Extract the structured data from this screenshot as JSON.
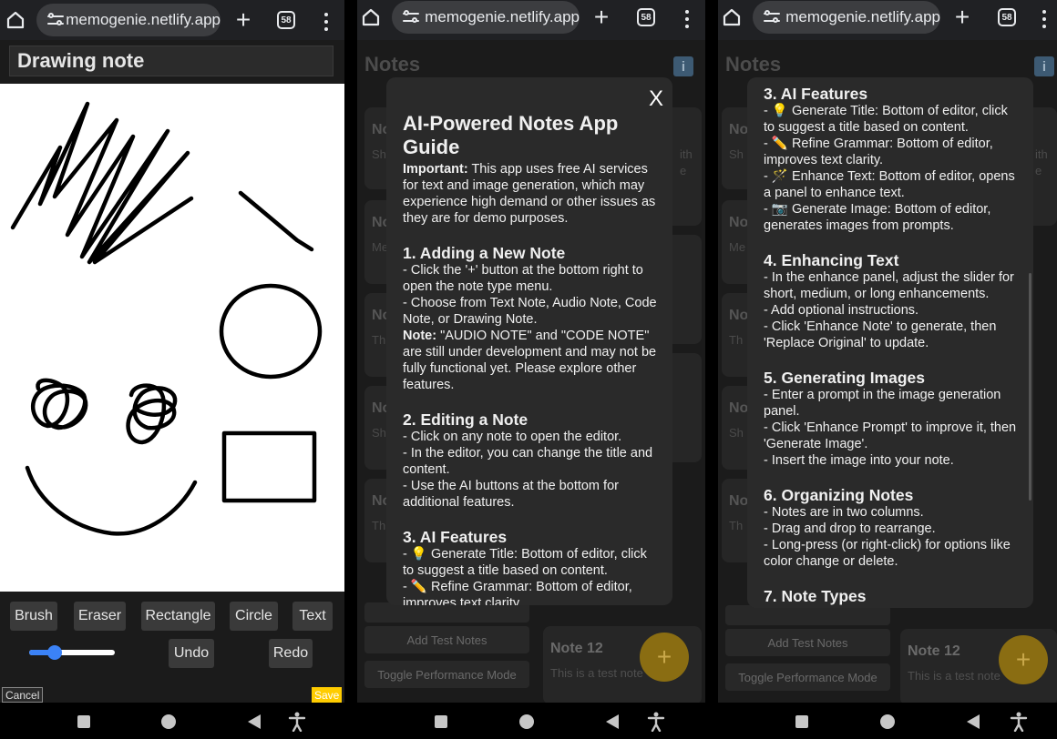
{
  "browser": {
    "url": "memogenie.netlify.app",
    "tab_count": "58"
  },
  "drawing": {
    "title": "Drawing note",
    "tools": [
      "Brush",
      "Eraser",
      "Rectangle",
      "Circle",
      "Text"
    ],
    "undo": "Undo",
    "redo": "Redo",
    "cancel": "Cancel",
    "save": "Save",
    "brush_size_fraction": 0.3,
    "save_color": "#ffcc00"
  },
  "notes": {
    "header": "Notes",
    "info_icon": "i",
    "cards_letters": [
      "No",
      "No",
      "No",
      "No",
      "No"
    ],
    "card_snippets": [
      "Sh",
      "Me he",
      "Th",
      "Sh",
      "Th"
    ],
    "right_snippets": [
      "ith",
      "e"
    ],
    "add_test_notes": "Add Test Notes",
    "toggle_performance": "Toggle Performance Mode",
    "note12_title": "Note 12",
    "note12_text": "This is a test note",
    "fab": "+"
  },
  "guide": {
    "close": "X",
    "title": "AI-Powered Notes App Guide",
    "important_label": "Important:",
    "important_text": " This app uses free AI services for text and image generation, which may experience high demand or other issues as they are for demo purposes.",
    "s1_title": "1. Adding a New Note",
    "s1_l1": "- Click the '+' button at the bottom right to open the note type menu.",
    "s1_l2": "- Choose from Text Note, Audio Note, Code Note, or Drawing Note.",
    "s1_note_label": "Note:",
    "s1_note_text": " \"AUDIO NOTE\" and \"CODE NOTE\" are still under development and may not be fully functional yet. Please explore other features.",
    "s2_title": "2. Editing a Note",
    "s2_l1": "- Click on any note to open the editor.",
    "s2_l2": "- In the editor, you can change the title and content.",
    "s2_l3": "- Use the AI buttons at the bottom for additional features.",
    "s3_title": "3. AI Features",
    "s3_l1": "- 💡 Generate Title: Bottom of editor, click to suggest a title based on content.",
    "s3_l2": "- ✏️ Refine Grammar: Bottom of editor, improves text clarity.",
    "s3_l3": "- 🪄 Enhance Text: Bottom of editor, opens a panel to enhance text.",
    "s3_l4": "- 📷 Generate Image: Bottom of editor, generates images from prompts.",
    "s4_title": "4. Enhancing Text",
    "s4_l1": "- In the enhance panel, adjust the slider for short, medium, or long enhancements.",
    "s4_l2": "- Add optional instructions.",
    "s4_l3": "- Click 'Enhance Note' to generate, then 'Replace Original' to update.",
    "s5_title": "5. Generating Images",
    "s5_l1": "- Enter a prompt in the image generation panel.",
    "s5_l2": "- Click 'Enhance Prompt' to improve it, then 'Generate Image'.",
    "s5_l3": "- Insert the image into your note.",
    "s6_title": "6. Organizing Notes",
    "s6_l1": "- Notes are in two columns.",
    "s6_l2": "- Drag and drop to rearrange.",
    "s6_l3": "- Long-press (or right-click) for options like color change or delete.",
    "s7_title": "7. Note Types"
  }
}
